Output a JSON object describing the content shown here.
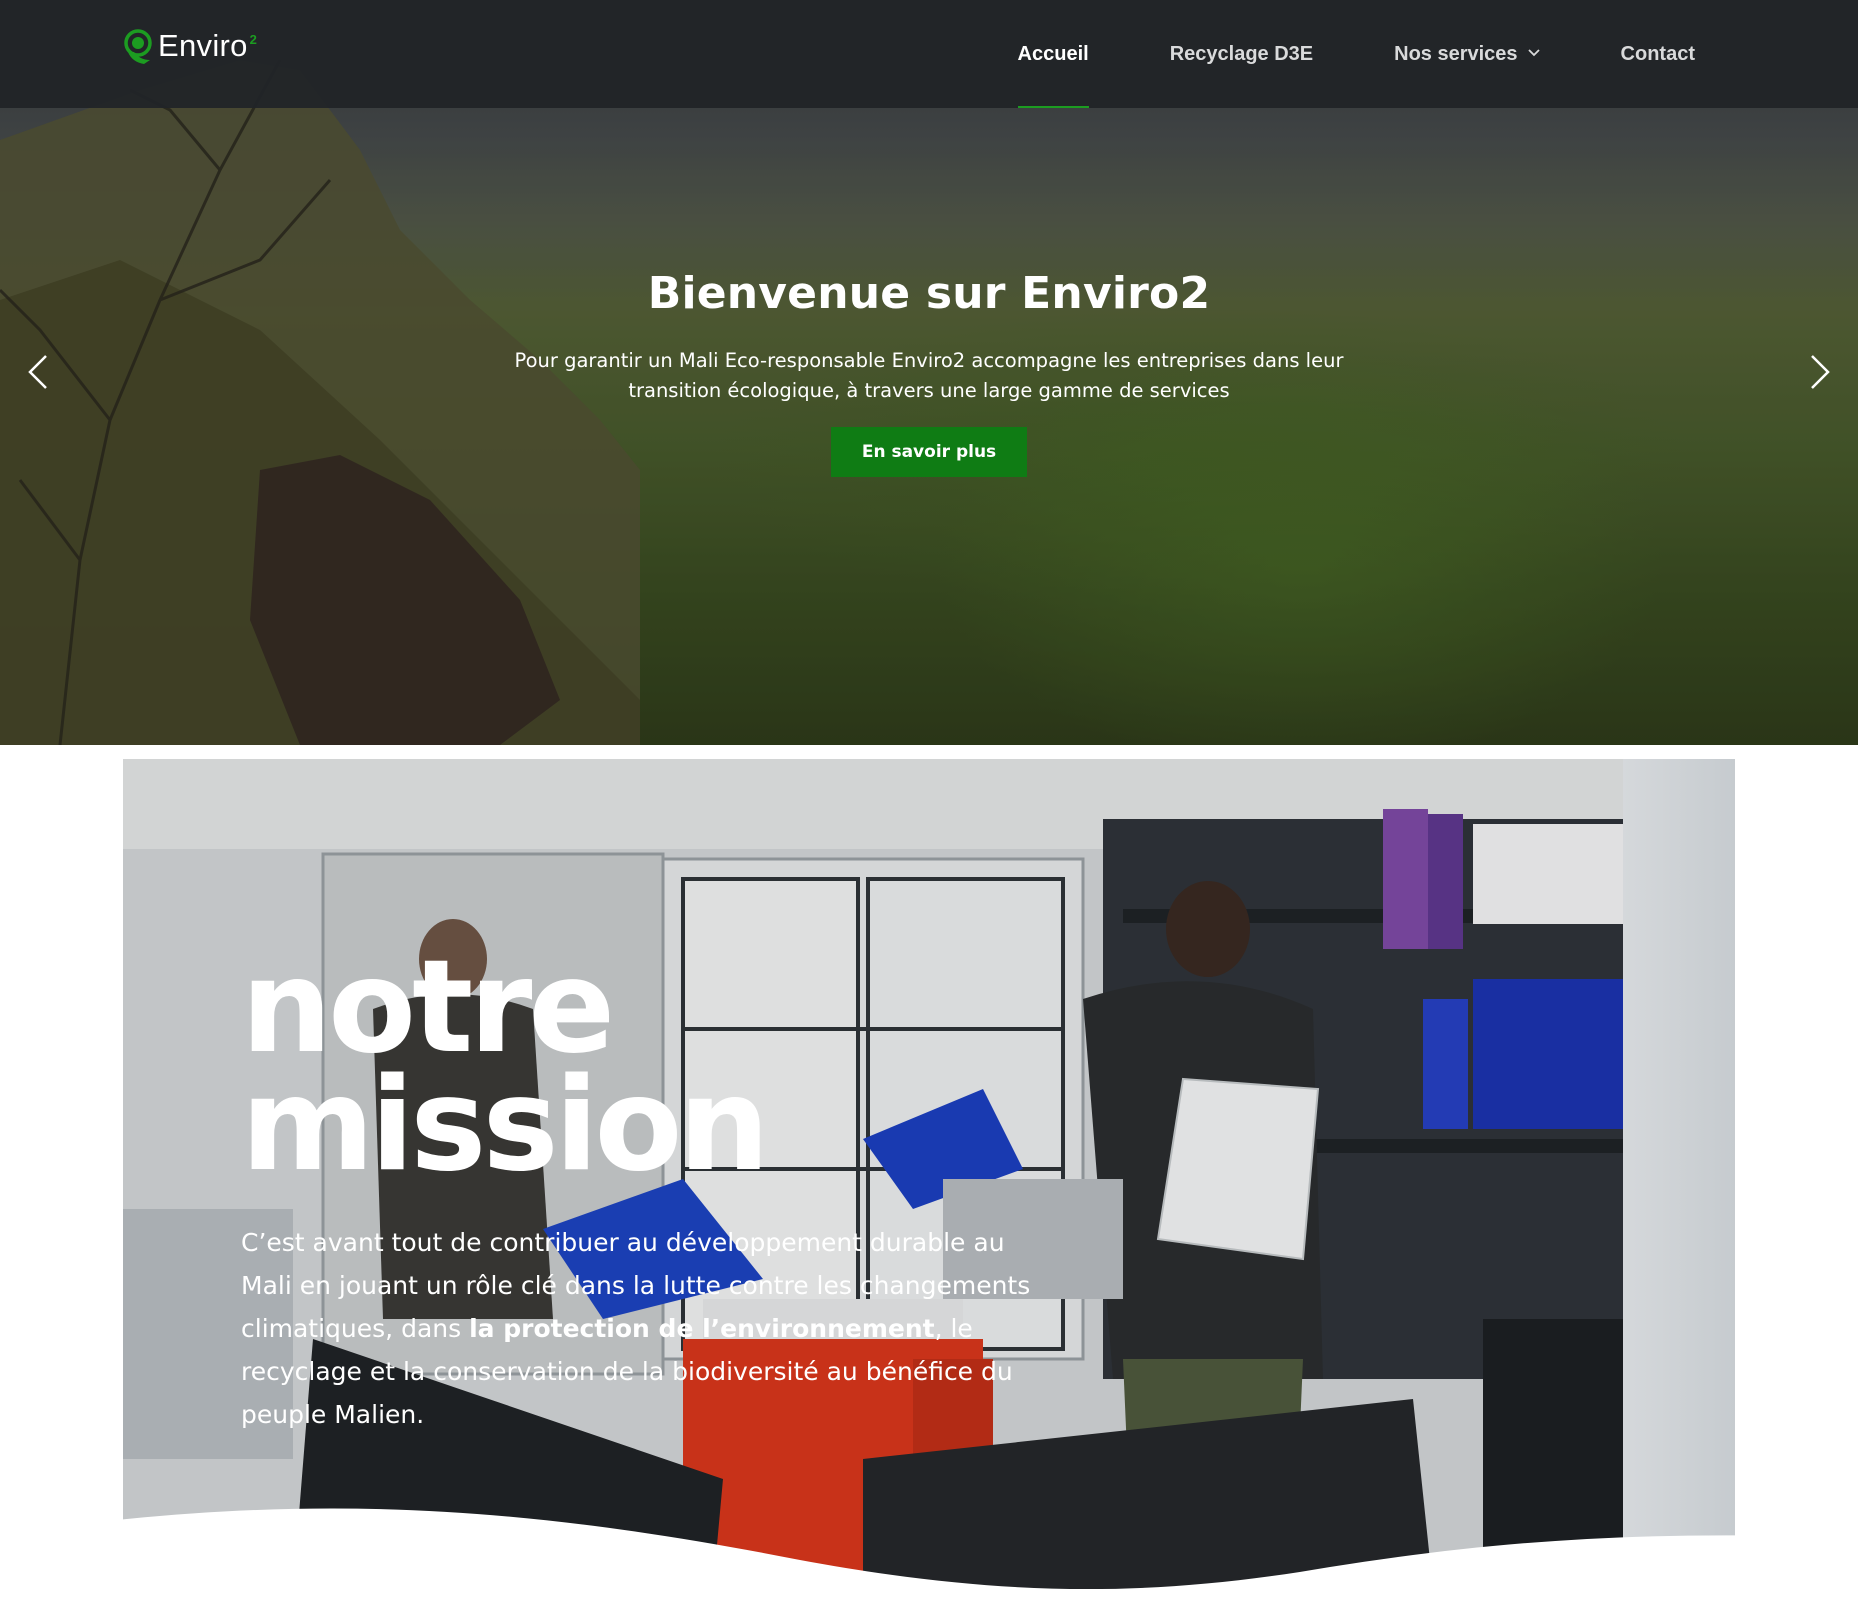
{
  "brand": {
    "name": "Enviro",
    "superscript": "2",
    "accent_color": "#1c9c21",
    "logo_icon": "leaf-globe-icon"
  },
  "nav": {
    "items": [
      {
        "label": "Accueil",
        "active": true
      },
      {
        "label": "Recyclage D3E",
        "active": false
      },
      {
        "label": "Nos services",
        "active": false,
        "has_dropdown": true
      },
      {
        "label": "Contact",
        "active": false
      }
    ],
    "dropdown_icon": "chevron-down-icon"
  },
  "hero": {
    "title": "Bienvenue sur Enviro2",
    "description": "Pour garantir un Mali Eco-responsable Enviro2 accompagne les entreprises dans leur transition écologique, à travers une large gamme de services",
    "button_label": "En savoir plus",
    "button_color": "#0f7c14",
    "prev_icon": "chevron-left-icon",
    "next_icon": "chevron-right-icon"
  },
  "mission": {
    "title_line1": "notre",
    "title_line2": "mission",
    "text_before": "C’est avant tout de contribuer au développement durable au Mali en jouant un rôle clé dans la lutte contre les changements climatiques, dans ",
    "text_bold": "la protection de l’environnement",
    "text_after": ", le recyclage et la conservation de la biodiversité au bénéfice du peuple Malien."
  }
}
